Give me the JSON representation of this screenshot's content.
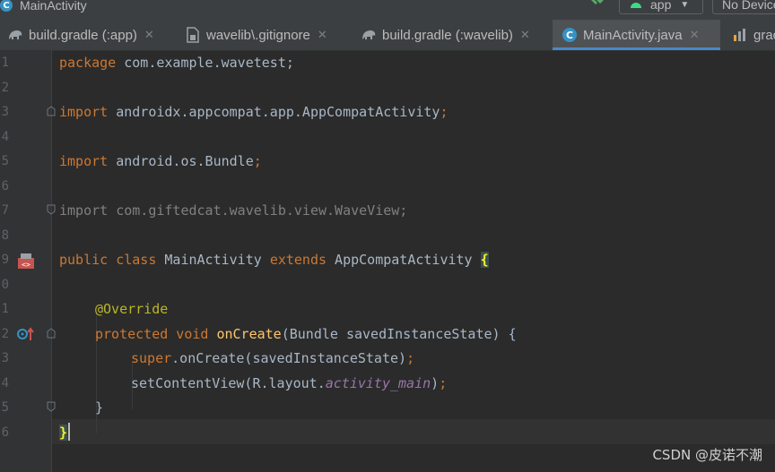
{
  "window": {
    "title": "MainActivity",
    "run_config": "app",
    "device": "No Devices"
  },
  "tabs": [
    {
      "label": "build.gradle (:app)",
      "icon": "gradle-elephant-icon"
    },
    {
      "label": "wavelib\\.gitignore",
      "icon": "gitignore-file-icon"
    },
    {
      "label": "build.gradle (:wavelib)",
      "icon": "gradle-elephant-icon"
    },
    {
      "label": "MainActivity.java",
      "icon": "java-class-icon",
      "active": true
    },
    {
      "label": "grac",
      "icon": "gradle-chart-icon"
    }
  ],
  "line_numbers": [
    "1",
    "2",
    "3",
    "4",
    "5",
    "6",
    "7",
    "8",
    "9",
    "0",
    "1",
    "2",
    "3",
    "4",
    "5",
    "6"
  ],
  "code": {
    "l1_kw": "package",
    "l1_rest": " com.example.wavetest;",
    "l3_kw": "import",
    "l3_rest": " androidx.appcompat.app.AppCompatActivity",
    "l3_semi": ";",
    "l5_kw": "import",
    "l5_rest": " android.os.Bundle",
    "l5_semi": ";",
    "l7_text": "import com.giftedcat.wavelib.view.WaveView;",
    "l9_kw1": "public class",
    "l9_name": " MainActivity ",
    "l9_kw2": "extends",
    "l9_super": " AppCompatActivity ",
    "l9_brace": "{",
    "l11_annot": "@Override",
    "l12_kw": "protected void",
    "l12_method": " onCreate",
    "l12_rest": "(Bundle savedInstanceState) {",
    "l13_kw": "super",
    "l13_rest": ".onCreate(savedInstanceState)",
    "l13_semi": ";",
    "l14_call": "setContentView(R.layout.",
    "l14_field": "activity_main",
    "l14_close": ")",
    "l14_semi": ";",
    "l15_brace": "}",
    "l16_brace": "}"
  },
  "watermark": "CSDN @皮诺不潮",
  "colors": {
    "editor_bg": "#2b2b2b",
    "keyword": "#cc7832",
    "annotation": "#bbb529",
    "method": "#ffc66d",
    "field": "#9876aa",
    "accent": "#4a88c7"
  }
}
